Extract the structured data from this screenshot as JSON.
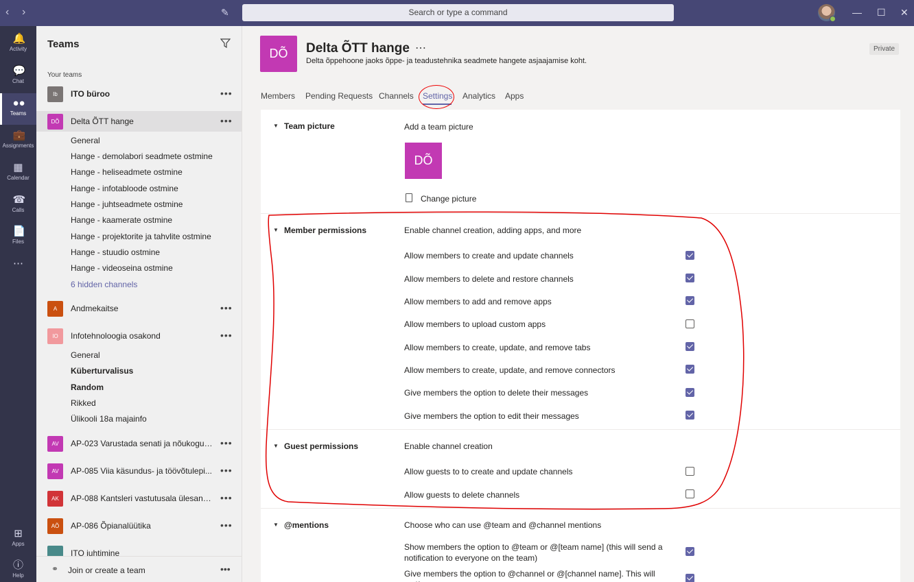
{
  "search": {
    "placeholder": "Search or type a command"
  },
  "rail": [
    {
      "label": "Activity",
      "icon": "bell-icon"
    },
    {
      "label": "Chat",
      "icon": "chat-icon"
    },
    {
      "label": "Teams",
      "icon": "teams-icon"
    },
    {
      "label": "Assignments",
      "icon": "assignments-icon"
    },
    {
      "label": "Calendar",
      "icon": "calendar-icon"
    },
    {
      "label": "Calls",
      "icon": "phone-icon"
    },
    {
      "label": "Files",
      "icon": "file-icon"
    },
    {
      "label": "Apps",
      "icon": "apps-icon"
    },
    {
      "label": "Help",
      "icon": "help-icon"
    }
  ],
  "panel": {
    "title": "Teams",
    "your_teams": "Your teams",
    "teams": [
      {
        "initials": "Ib",
        "name": "ITO büroo",
        "color": "#7a7574"
      },
      {
        "initials": "DÕ",
        "name": "Delta ÕTT hange",
        "color": "#c239b3"
      },
      {
        "initials": "A",
        "name": "Andmekaitse",
        "color": "#ca5010"
      },
      {
        "initials": "IO",
        "name": "Infotehnoloogia osakond",
        "color": "#f1999d"
      },
      {
        "initials": "AV",
        "name": "AP-023 Varustada senati ja nõukogu s...",
        "color": "#c239b3"
      },
      {
        "initials": "AV",
        "name": "AP-085 Viia käsundus- ja töövõtulepi...",
        "color": "#c239b3"
      },
      {
        "initials": "AK",
        "name": "AP-088 Kantsleri vastutusala ülesanne...",
        "color": "#d13438"
      },
      {
        "initials": "AÕ",
        "name": "AP-086 Õpianalüütika",
        "color": "#ca5010"
      },
      {
        "initials": "",
        "name": "ITO juhtimine",
        "color": "#498a8a"
      }
    ],
    "delta_channels": [
      "General",
      "Hange - demolabori seadmete ostmine",
      "Hange - heliseadmete ostmine",
      "Hange - infotabloode ostmine",
      "Hange - juhtseadmete ostmine",
      "Hange - kaamerate ostmine",
      "Hange - projektorite ja tahvlite ostmine",
      "Hange - stuudio ostmine",
      "Hange - videoseina ostmine"
    ],
    "hidden_channels": "6 hidden channels",
    "io_channels": [
      "General",
      "Küberturvalisus",
      "Random",
      "Rikked",
      "Ülikooli 18a majainfo"
    ],
    "join_label": "Join or create a team"
  },
  "header": {
    "initials": "DÕ",
    "title": "Delta ÕTT hange",
    "description": "Delta õppehoone jaoks õppe- ja teadustehnika seadmete hangete asjaajamise koht.",
    "privacy": "Private"
  },
  "tabs": [
    "Members",
    "Pending Requests",
    "Channels",
    "Settings",
    "Analytics",
    "Apps"
  ],
  "active_tab": "Settings",
  "settings": {
    "team_picture": {
      "title": "Team picture",
      "subtitle": "Add a team picture",
      "initials": "DÕ",
      "change": "Change picture"
    },
    "member_permissions": {
      "title": "Member permissions",
      "subtitle": "Enable channel creation, adding apps, and more",
      "options": [
        {
          "label": "Allow members to create and update channels",
          "checked": true
        },
        {
          "label": "Allow members to delete and restore channels",
          "checked": true
        },
        {
          "label": "Allow members to add and remove apps",
          "checked": true
        },
        {
          "label": "Allow members to upload custom apps",
          "checked": false
        },
        {
          "label": "Allow members to create, update, and remove tabs",
          "checked": true
        },
        {
          "label": "Allow members to create, update, and remove connectors",
          "checked": true
        },
        {
          "label": "Give members the option to delete their messages",
          "checked": true
        },
        {
          "label": "Give members the option to edit their messages",
          "checked": true
        }
      ]
    },
    "guest_permissions": {
      "title": "Guest permissions",
      "subtitle": "Enable channel creation",
      "options": [
        {
          "label": "Allow guests to to create and update channels",
          "checked": false
        },
        {
          "label": "Allow guests to delete channels",
          "checked": false
        }
      ]
    },
    "mentions": {
      "title": "@mentions",
      "subtitle": "Choose who can use @team and @channel mentions",
      "options": [
        {
          "label": "Show members the option to @team or @[team name] (this will send a notification to everyone on the team)",
          "checked": true
        },
        {
          "label": "Give members the option to @channel or @[channel name]. This will notify",
          "checked": true
        }
      ]
    }
  },
  "colors": {
    "accent": "#6264a7",
    "titlebar": "#464775",
    "rail": "#33344a",
    "annotation": "#e00000"
  }
}
